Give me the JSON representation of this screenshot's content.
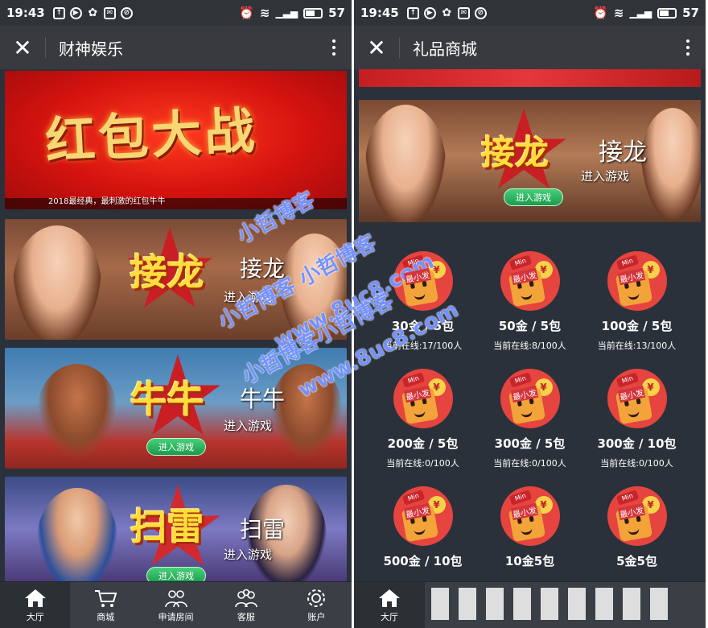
{
  "left": {
    "status": {
      "time": "19:43",
      "battery": "57"
    },
    "title": "财神娱乐",
    "top_banner": {
      "title": "红包大战",
      "subtitle": "2018最经典，最刺激的红包牛牛"
    },
    "games": [
      {
        "name": "接龙",
        "logo": "接龙",
        "enter": "进入游戏",
        "button": "进入游戏"
      },
      {
        "name": "牛牛",
        "logo": "牛牛",
        "enter": "进入游戏",
        "button": "进入游戏"
      },
      {
        "name": "扫雷",
        "logo": "扫雷",
        "enter": "进入游戏",
        "button": "进入游戏"
      }
    ],
    "nav": [
      {
        "label": "大厅",
        "icon": "home-icon"
      },
      {
        "label": "商城",
        "icon": "cart-icon"
      },
      {
        "label": "申请房间",
        "icon": "group-icon"
      },
      {
        "label": "客服",
        "icon": "service-icon"
      },
      {
        "label": "账户",
        "icon": "gear-icon"
      }
    ]
  },
  "right": {
    "status": {
      "time": "19:45",
      "battery": "57"
    },
    "title": "礼品商城",
    "banner": {
      "name": "接龙",
      "logo": "接龙",
      "enter": "进入游戏",
      "button": "进入游戏"
    },
    "packet_icon": {
      "badge": "Min",
      "label": "最小发",
      "coin": "¥"
    },
    "packets": [
      {
        "title": "30金 / 5包",
        "online": "当前在线:17/100人"
      },
      {
        "title": "50金 / 5包",
        "online": "当前在线:8/100人"
      },
      {
        "title": "100金 / 5包",
        "online": "当前在线:13/100人"
      },
      {
        "title": "200金 / 5包",
        "online": "当前在线:0/100人"
      },
      {
        "title": "300金 / 5包",
        "online": "当前在线:0/100人"
      },
      {
        "title": "300金 / 10包",
        "online": "当前在线:0/100人"
      },
      {
        "title": "500金 / 10包",
        "online": ""
      },
      {
        "title": "10金5包",
        "online": ""
      },
      {
        "title": "5金5包",
        "online": ""
      }
    ],
    "nav": [
      {
        "label": "大厅",
        "icon": "home-icon"
      }
    ]
  },
  "watermarks": [
    "小哲博客",
    "小哲博客 小哲博客",
    "www.8uc8.com",
    "小哲博客小哲博客",
    "www.8uc8.com"
  ],
  "colors": {
    "titlebar": "#393a3f",
    "status": "#2f3439",
    "nav": "#3a3f45",
    "enter_green": "#1b9a4c",
    "packet_red": "#e6443f"
  }
}
